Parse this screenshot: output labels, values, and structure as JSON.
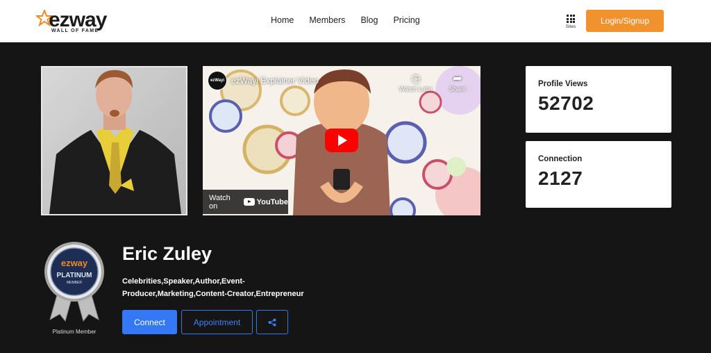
{
  "header": {
    "logo_text": "ezway",
    "logo_tagline": "WALL OF FAME",
    "nav": [
      {
        "label": "Home"
      },
      {
        "label": "Members"
      },
      {
        "label": "Blog"
      },
      {
        "label": "Pricing"
      }
    ],
    "sites_label": "Sites",
    "sites_icon": "grid-icon",
    "login_label": "Login/Signup",
    "accent_color": "#f0932f"
  },
  "video": {
    "channel_badge": "ezWayi",
    "title": "ezWayi Explainer Video",
    "watch_later_label": "Watch Later",
    "share_label": "Share",
    "watch_on_label": "Watch on",
    "youtube_label": "YouTube"
  },
  "stats": {
    "views_label": "Profile Views",
    "views_value": "52702",
    "connection_label": "Connection",
    "connection_value": "2127"
  },
  "profile": {
    "name": "Eric Zuley",
    "categories": "Celebrities,Speaker,Author,Event-Producer,Marketing,Content-Creator,Entrepreneur",
    "badge_brand": "ezway",
    "badge_title": "PLATINUM",
    "badge_sub": "MEMBER",
    "badge_label": "Platinum Member",
    "connect_label": "Connect",
    "appointment_label": "Appointment",
    "share_icon": "share-icon",
    "button_color": "#3478f6"
  }
}
